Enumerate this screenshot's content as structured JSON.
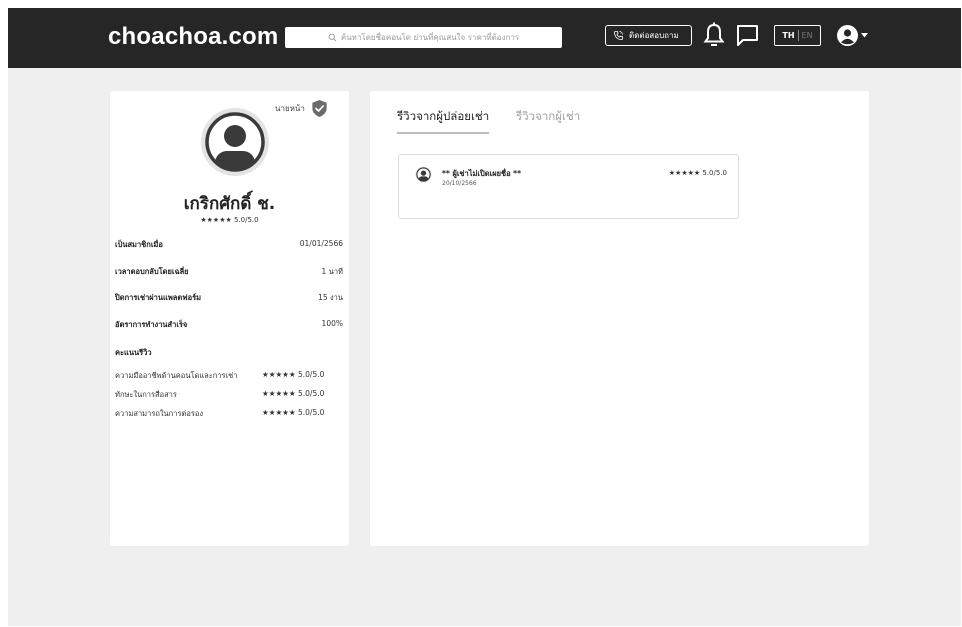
{
  "header": {
    "logo": "choachoa.com",
    "search_placeholder": "ค้นหาโดยชื่อคอนโด ย่านที่คุณสนใจ ราคาที่ต้องการ",
    "contact_label": "ติดต่อสอบถาม",
    "lang_th": "TH",
    "lang_en": "EN"
  },
  "profile": {
    "badge_label": "นายหน้า",
    "name": "เกริกศักดิ์ ช.",
    "rating": "★★★★★ 5.0/5.0",
    "stats": [
      {
        "label": "เป็นสมาชิกเมื่อ",
        "value": "01/01/2566"
      },
      {
        "label": "เวลาตอบกลับโดยเฉลี่ย",
        "value": "1 นาที"
      },
      {
        "label": "ปิดการเช่าผ่านแพลตฟอร์ม",
        "value": "15 งาน"
      },
      {
        "label": "อัตราการทำงานสำเร็จ",
        "value": "100%"
      }
    ],
    "scores_title": "คะแนนรีวิว",
    "scores": [
      {
        "label": "ความมืออาชีพด้านคอนโดและการเช่า",
        "value": "★★★★★ 5.0/5.0"
      },
      {
        "label": "ทักษะในการสื่อสาร",
        "value": "★★★★★ 5.0/5.0"
      },
      {
        "label": "ความสามารถในการต่อรอง",
        "value": "★★★★★ 5.0/5.0"
      }
    ]
  },
  "reviews": {
    "tabs": [
      {
        "label": "รีวิวจากผู้ปล่อยเช่า",
        "active": true
      },
      {
        "label": "รีวิวจากผู้เช่า",
        "active": false
      }
    ],
    "items": [
      {
        "name": "** ผู้เช่าไม่เปิดเผยชื่อ **",
        "date": "20/10/2566",
        "rating": "★★★★★ 5.0/5.0"
      }
    ]
  },
  "colors": {
    "header_bg": "#262626",
    "page_bg": "#efefef",
    "card_bg": "#ffffff",
    "verified_badge": "#6b6b6b"
  },
  "icons": [
    "search-icon",
    "phone-icon",
    "bell-icon",
    "chat-icon",
    "user-icon",
    "chevron-down-icon",
    "verified-check-icon",
    "avatar-icon"
  ]
}
